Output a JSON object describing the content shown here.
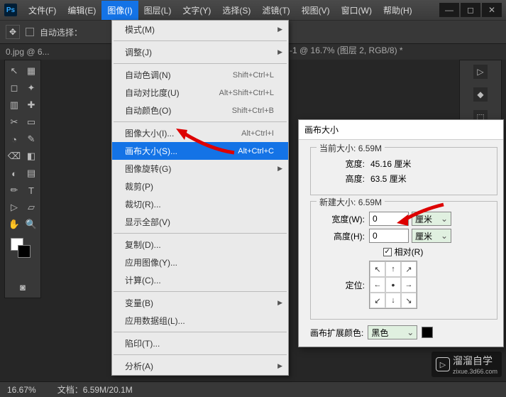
{
  "app": {
    "logo": "Ps"
  },
  "menus": [
    "文件(F)",
    "编辑(E)",
    "图像(I)",
    "图层(L)",
    "文字(Y)",
    "选择(S)",
    "滤镜(T)",
    "视图(V)",
    "窗口(W)",
    "帮助(H)"
  ],
  "active_menu_index": 2,
  "options": {
    "auto_select": "自动选择："
  },
  "tabs": {
    "left": "0.jpg @ 6...",
    "right": "-1 @ 16.7% (图层 2, RGB/8) *"
  },
  "dropdown": {
    "groups": [
      [
        {
          "label": "模式(M)",
          "sub": true
        }
      ],
      [
        {
          "label": "调整(J)",
          "sub": true
        }
      ],
      [
        {
          "label": "自动色调(N)",
          "shortcut": "Shift+Ctrl+L"
        },
        {
          "label": "自动对比度(U)",
          "shortcut": "Alt+Shift+Ctrl+L"
        },
        {
          "label": "自动颜色(O)",
          "shortcut": "Shift+Ctrl+B"
        }
      ],
      [
        {
          "label": "图像大小(I)...",
          "shortcut": "Alt+Ctrl+I"
        },
        {
          "label": "画布大小(S)...",
          "shortcut": "Alt+Ctrl+C",
          "hl": true
        },
        {
          "label": "图像旋转(G)",
          "sub": true
        },
        {
          "label": "裁剪(P)"
        },
        {
          "label": "裁切(R)..."
        },
        {
          "label": "显示全部(V)"
        }
      ],
      [
        {
          "label": "复制(D)..."
        },
        {
          "label": "应用图像(Y)..."
        },
        {
          "label": "计算(C)..."
        }
      ],
      [
        {
          "label": "变量(B)",
          "sub": true
        },
        {
          "label": "应用数据组(L)..."
        }
      ],
      [
        {
          "label": "陷印(T)..."
        }
      ],
      [
        {
          "label": "分析(A)",
          "sub": true
        }
      ]
    ]
  },
  "dialog": {
    "title": "画布大小",
    "current": {
      "legend": "当前大小:",
      "size": "6.59M",
      "w_label": "宽度:",
      "w_val": "45.16 厘米",
      "h_label": "高度:",
      "h_val": "63.5 厘米"
    },
    "newsize": {
      "legend": "新建大小:",
      "size": "6.59M",
      "w_label": "宽度(W):",
      "w_val": "0",
      "w_unit": "厘米",
      "h_label": "高度(H):",
      "h_val": "0",
      "h_unit": "厘米",
      "relative": "相对(R)",
      "anchor_label": "定位:"
    },
    "ext": {
      "label": "画布扩展颜色:",
      "value": "黑色"
    }
  },
  "status": {
    "zoom": "16.67%",
    "doc": "文档：6.59M/20.1M"
  },
  "tools": [
    "↖",
    "▦",
    "◻",
    "✦",
    "▥",
    "✚",
    "✂",
    "▭",
    "◔",
    "✎",
    "⌫",
    "◧",
    "◐",
    "▤",
    "✏",
    "T",
    "▷",
    "▱",
    "✋",
    "🔍"
  ],
  "rp": [
    "▷",
    "◆",
    "⬚",
    "≡",
    "▤"
  ],
  "watermark": {
    "name": "溜溜自学",
    "url": "zixue.3d66.com",
    "icon": "▷"
  }
}
